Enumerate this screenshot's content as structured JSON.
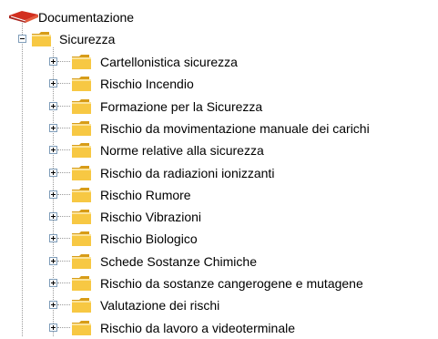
{
  "tree": {
    "root": {
      "label": "Documentazione",
      "icon": "red-book-icon"
    },
    "folder": {
      "label": "Sicurezza",
      "icon": "folder-icon",
      "expanded": true
    },
    "children": [
      {
        "label": "Cartellonistica sicurezza"
      },
      {
        "label": "Rischio Incendio"
      },
      {
        "label": "Formazione per la Sicurezza"
      },
      {
        "label": "Rischio da movimentazione manuale dei carichi"
      },
      {
        "label": "Norme relative alla sicurezza"
      },
      {
        "label": "Rischio da radiazioni ionizzanti"
      },
      {
        "label": "Rischio Rumore"
      },
      {
        "label": "Rischio Vibrazioni"
      },
      {
        "label": "Rischio Biologico"
      },
      {
        "label": "Schede Sostanze Chimiche"
      },
      {
        "label": "Rischio da sostanze cangerogene e mutagene"
      },
      {
        "label": "Valutazione dei rischi"
      },
      {
        "label": "Rischio da lavoro a videoterminale"
      }
    ]
  },
  "colors": {
    "folder": "#f7c843",
    "folder_dark": "#d79c18",
    "book": "#d22f1f",
    "connector": "#9a9a9a"
  }
}
